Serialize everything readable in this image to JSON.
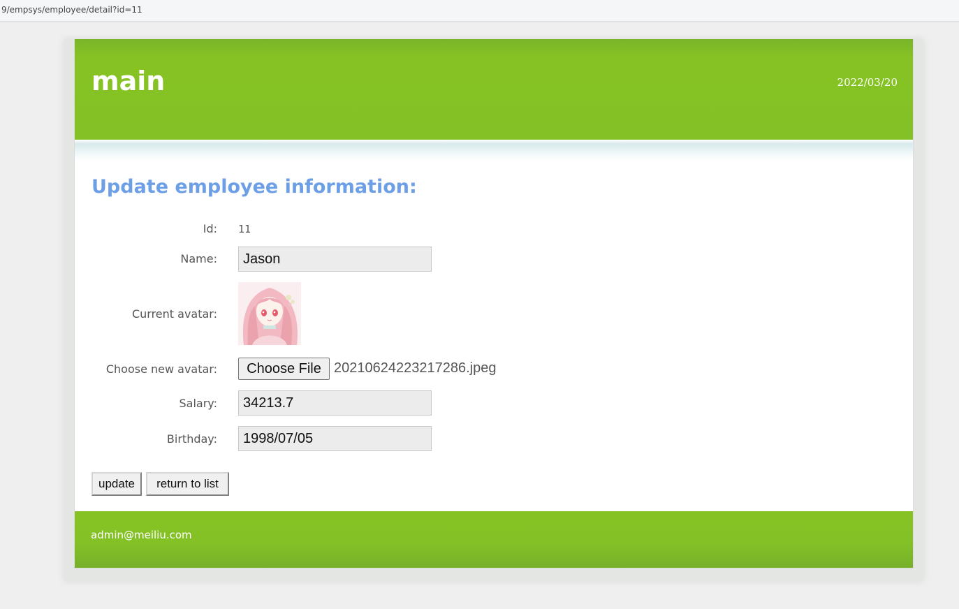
{
  "browser": {
    "url": "9/empsys/employee/detail?id=11"
  },
  "header": {
    "title": "main",
    "date": "2022/03/20"
  },
  "form": {
    "heading": "Update employee information:",
    "id_label": "Id:",
    "id_value": "11",
    "name_label": "Name:",
    "name_value": "Jason",
    "current_avatar_label": "Current avatar:",
    "new_avatar_label": "Choose new avatar:",
    "choose_file_label": "Choose File",
    "file_name": "20210624223217286.jpeg",
    "salary_label": "Salary:",
    "salary_value": "34213.7",
    "birthday_label": "Birthday:",
    "birthday_value": "1998/07/05",
    "update_label": "update",
    "return_label": "return to list"
  },
  "footer": {
    "email": "admin@meiliu.com"
  },
  "colors": {
    "header_green": "#84c126",
    "heading_blue": "#6d9fe6",
    "page_background": "#efefef"
  },
  "icons": {
    "avatar": "anime-girl-avatar"
  }
}
